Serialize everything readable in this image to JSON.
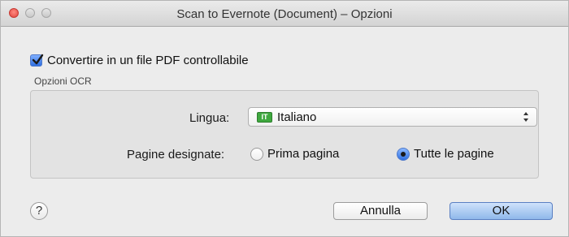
{
  "window": {
    "title": "Scan to Evernote (Document) – Opzioni"
  },
  "pdf_option": {
    "label": "Convertire in un file PDF controllabile",
    "checked": true
  },
  "ocr_group": {
    "title": "Opzioni OCR",
    "lingua_label": "Lingua:",
    "lingua_flag": "IT",
    "lingua_value": "Italiano",
    "pagine_label": "Pagine designate:",
    "radio_first": "Prima pagina",
    "radio_all": "Tutte le pagine",
    "selected_radio": "Tutte le pagine"
  },
  "footer": {
    "help_label": "?",
    "cancel_label": "Annulla",
    "ok_label": "OK"
  },
  "colors": {
    "accent": "#2f6fe0",
    "window_bg": "#ececec"
  }
}
